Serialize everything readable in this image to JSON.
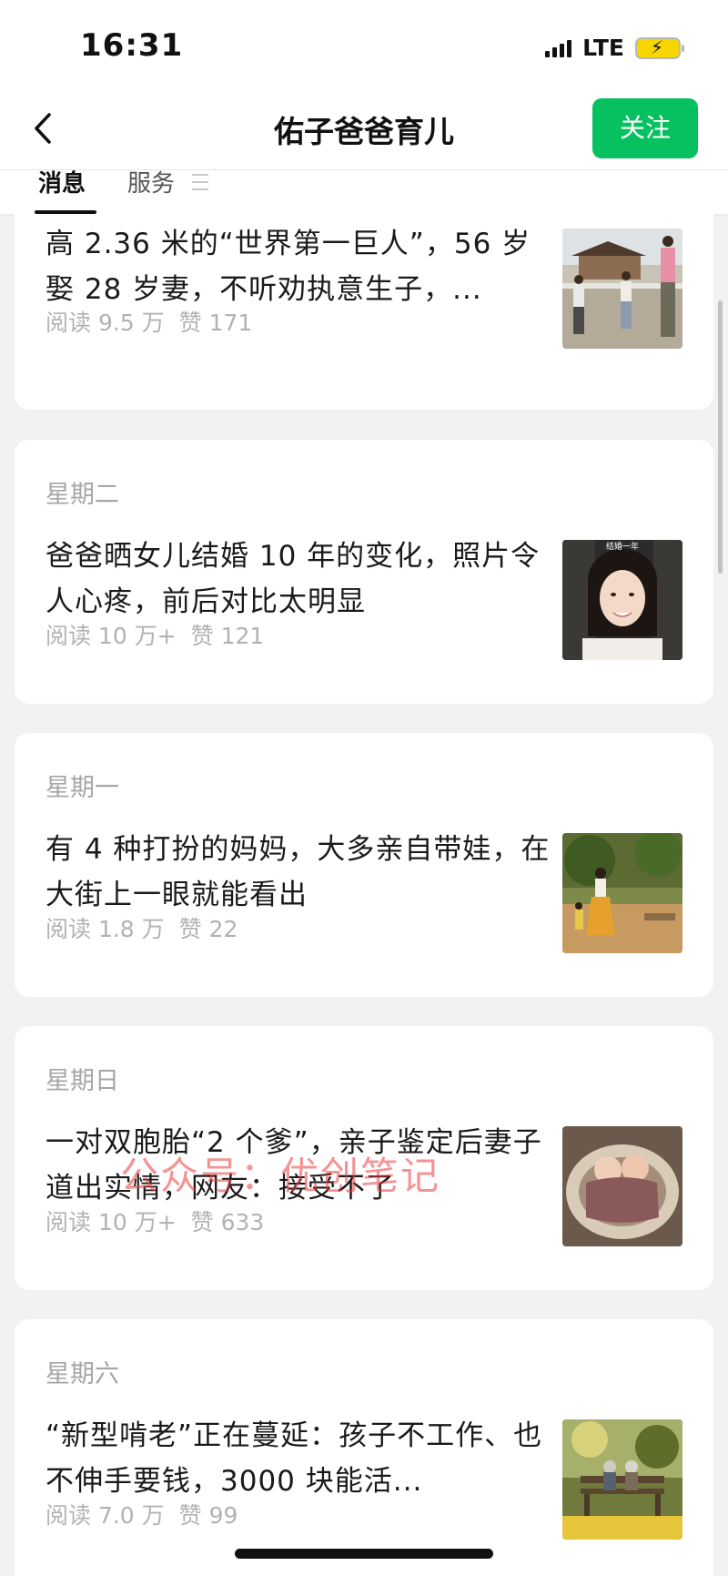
{
  "status_bar": {
    "time": "16:31",
    "network": "LTE"
  },
  "nav": {
    "title": "佑子爸爸育儿",
    "follow_label": "关注",
    "back_icon": "chevron-left-icon"
  },
  "tabs": {
    "messages_label": "消息",
    "services_label": "服务",
    "services_icon": "menu-icon"
  },
  "colors": {
    "accent_green": "#07c160",
    "watermark_red": "#eb3c3c"
  },
  "articles": [
    {
      "day": "",
      "title": "高 2.36 米的“世界第一巨人”，56 岁娶 28 岁妻，不听劝执意生子，...",
      "reads": "阅读 9.5 万",
      "likes": "赞 171",
      "thumb": "giant-couple-photo"
    },
    {
      "day": "星期二",
      "title": "爸爸晒女儿结婚 10 年的变化，照片令人心疼，前后对比太明显",
      "reads": "阅读 10 万+",
      "likes": "赞 121",
      "thumb": "smiling-woman-photo",
      "thumb_caption": "结婚一年"
    },
    {
      "day": "星期一",
      "title": "有 4 种打扮的妈妈，大多亲自带娃，在大街上一眼就能看出",
      "reads": "阅读 1.8 万",
      "likes": "赞 22",
      "thumb": "mother-child-photo"
    },
    {
      "day": "星期日",
      "title": "一对双胞胎“2 个爹”，亲子鉴定后妻子道出实情，网友：接受不了",
      "reads": "阅读 10 万+",
      "likes": "赞 633",
      "thumb": "sleeping-twins-photo"
    },
    {
      "day": "星期六",
      "title": "“新型啃老”正在蔓延：孩子不工作、也不伸手要钱，3000 块能活...",
      "reads": "阅读 7.0 万",
      "likes": "赞 99",
      "thumb": "elderly-bench-photo"
    }
  ],
  "watermark": "公众号：优创笔记"
}
